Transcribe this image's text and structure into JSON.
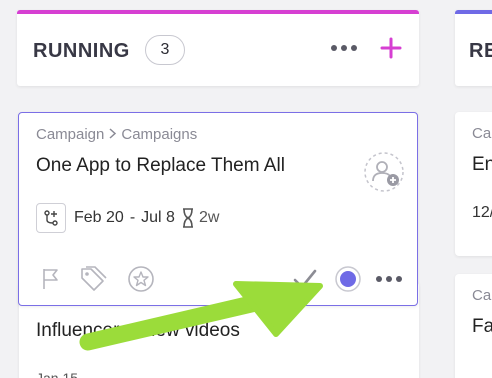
{
  "columns": [
    {
      "title": "RUNNING",
      "count": "3",
      "accent": "#d63fd2"
    },
    {
      "title": "RE",
      "accent": "#6f6ae6"
    }
  ],
  "main_card": {
    "breadcrumb": [
      "Campaign",
      "Campaigns"
    ],
    "title": "One App to Replace Them All",
    "start_date": "Feb 20",
    "date_separator": "-",
    "end_date": "Jul 8",
    "time_estimate": "2w",
    "status_color": "#6f6ae6"
  },
  "card_below": {
    "title": "Influencer review videos",
    "meta": "Jan 15"
  },
  "right_cards": [
    {
      "breadcrumb": "Ca",
      "title": "En",
      "date": "12/"
    },
    {
      "breadcrumb": "Ca",
      "title": "Fa"
    }
  ],
  "colors": {
    "background": "#f2f2f4",
    "annotation_arrow": "#9bdc3a"
  },
  "icons": {
    "header_more": "more-horizontal-icon",
    "header_add": "plus-icon",
    "assign": "add-assignee-icon",
    "dependency": "dependency-icon",
    "estimate": "hourglass-icon",
    "flag": "flag-icon",
    "tag": "tag-icon",
    "star": "star-icon",
    "check": "check-icon",
    "status": "status-circle-icon",
    "card_more": "more-horizontal-icon"
  }
}
